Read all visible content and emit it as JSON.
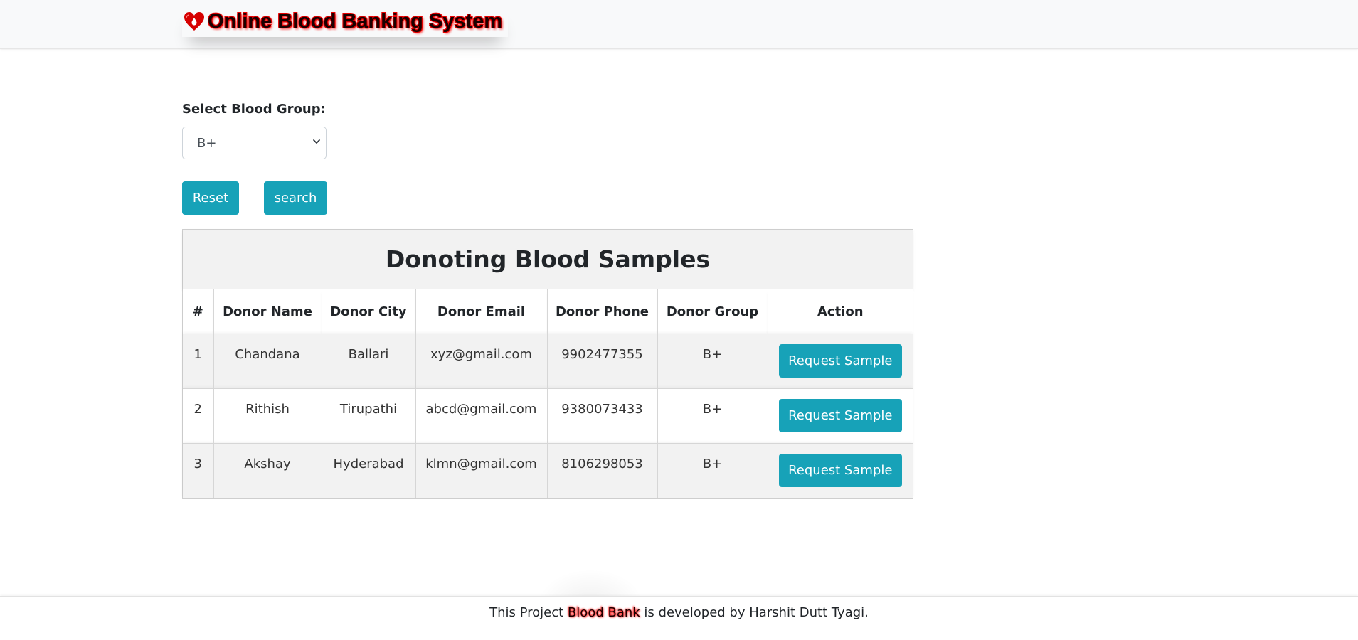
{
  "header": {
    "brand_title": "Online Blood Banking System",
    "brand_icon": "blood-drop-heart-icon",
    "brand_color": "#e60000"
  },
  "form": {
    "label": "Select Blood Group:",
    "selected_value": "B+",
    "reset_label": "Reset",
    "search_label": "search"
  },
  "table": {
    "title": "Donoting Blood Samples",
    "columns": [
      "#",
      "Donor Name",
      "Donor City",
      "Donor Email",
      "Donor Phone",
      "Donor Group",
      "Action"
    ],
    "rows": [
      {
        "num": "1",
        "name": "Chandana",
        "city": "Ballari",
        "email": "xyz@gmail.com",
        "phone": "9902477355",
        "group": "B+",
        "action": "Request Sample"
      },
      {
        "num": "2",
        "name": "Rithish",
        "city": "Tirupathi",
        "email": "abcd@gmail.com",
        "phone": "9380073433",
        "group": "B+",
        "action": "Request Sample"
      },
      {
        "num": "3",
        "name": "Akshay",
        "city": "Hyderabad",
        "email": "klmn@gmail.com",
        "phone": "8106298053",
        "group": "B+",
        "action": "Request Sample"
      }
    ]
  },
  "footer": {
    "prefix": "This Project",
    "highlight": "Blood Bank",
    "suffix": "is developed by Harshit Dutt Tyagi."
  },
  "colors": {
    "button": "#17a2b8",
    "header_bg": "#f8f9fa",
    "stripe": "#f2f2f2"
  }
}
